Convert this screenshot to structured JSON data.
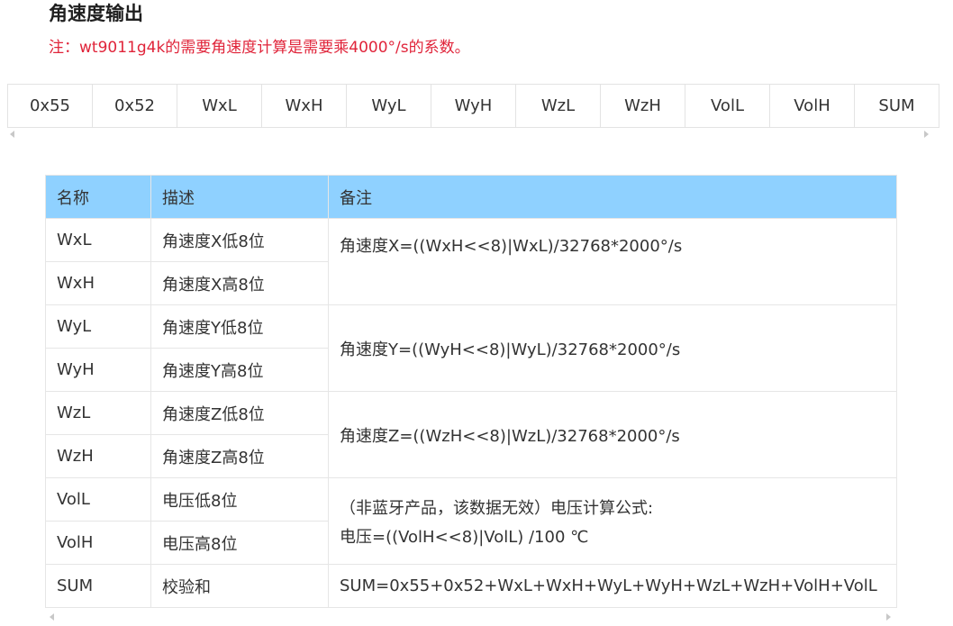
{
  "heading": "角速度输出",
  "note": "注：wt9011g4k的需要角速度计算是需要乘4000°/s的系数。",
  "protocol_bytes": [
    "0x55",
    "0x52",
    "WxL",
    "WxH",
    "WyL",
    "WyH",
    "WzL",
    "WzH",
    "VolL",
    "VolH",
    "SUM"
  ],
  "table": {
    "headers": [
      "名称",
      "描述",
      "备注"
    ],
    "rows": [
      {
        "name": "WxL",
        "desc": "角速度X低8位"
      },
      {
        "name": "WxH",
        "desc": "角速度X高8位"
      },
      {
        "name": "WyL",
        "desc": "角速度Y低8位"
      },
      {
        "name": "WyH",
        "desc": "角速度Y高8位"
      },
      {
        "name": "WzL",
        "desc": "角速度Z低8位"
      },
      {
        "name": "WzH",
        "desc": "角速度Z高8位"
      },
      {
        "name": "VolL",
        "desc": "电压低8位"
      },
      {
        "name": "VolH",
        "desc": "电压高8位"
      },
      {
        "name": "SUM",
        "desc": "校验和"
      }
    ],
    "remarks": {
      "x": "角速度X=((WxH<<8)|WxL)/32768*2000°/s",
      "y": "角速度Y=((WyH<<8)|WyL)/32768*2000°/s",
      "z": "角速度Z=((WzH<<8)|WzL)/32768*2000°/s",
      "vol_line1": "（非蓝牙产品，该数据无效）电压计算公式:",
      "vol_line2": "电压=((VolH<<8)|VolL) /100 ℃",
      "sum": "SUM=0x55+0x52+WxL+WxH+WyL+WyH+WzL+WzH+VolH+VolL"
    }
  }
}
